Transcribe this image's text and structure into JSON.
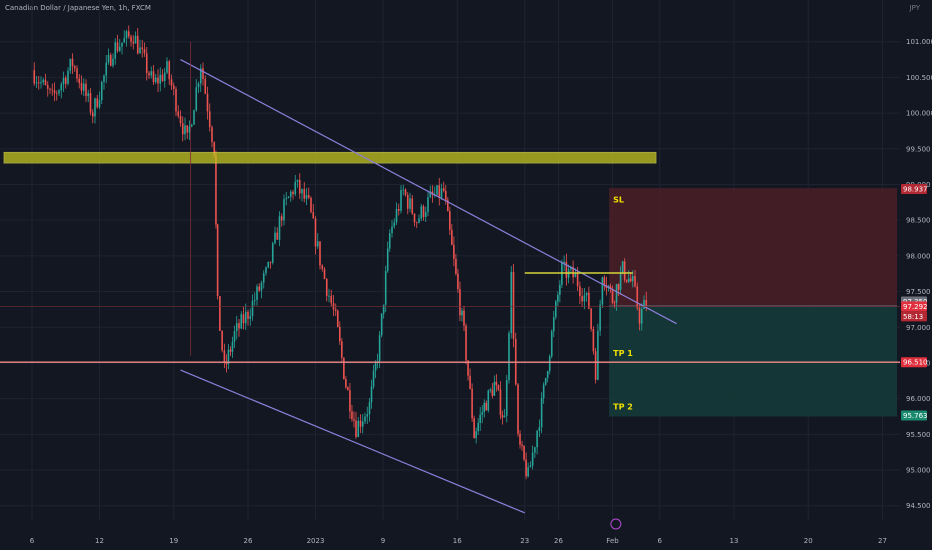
{
  "header": {
    "symbol": "Canadian Dollar / Japanese Yen, 1h, FXCM",
    "currency": "JPY"
  },
  "chart_data": {
    "type": "candlestick",
    "title": "Canadian Dollar / Japanese Yen, 1h, FXCM",
    "ylim": [
      94.3,
      101.5
    ],
    "y_ticks": [
      "94.500",
      "95.000",
      "95.500",
      "96.000",
      "96.500",
      "97.000",
      "97.500",
      "98.000",
      "98.500",
      "99.000",
      "99.500",
      "100.000",
      "100.500",
      "101.000"
    ],
    "x_ticks": [
      "6",
      "12",
      "19",
      "26",
      "2023",
      "9",
      "16",
      "23",
      "26",
      "Feb",
      "6",
      "13",
      "20",
      "27"
    ],
    "x_tick_index": [
      0,
      1.0,
      2.1,
      3.2,
      4.2,
      5.2,
      6.3,
      7.3,
      7.8,
      8.6,
      9.3,
      10.4,
      11.5,
      12.6
    ],
    "price_path": [
      [
        0,
        100.6
      ],
      [
        0.3,
        100.2
      ],
      [
        0.6,
        100.7
      ],
      [
        0.9,
        100.0
      ],
      [
        1.2,
        100.9
      ],
      [
        1.5,
        101.1
      ],
      [
        1.8,
        100.4
      ],
      [
        2.0,
        100.6
      ],
      [
        2.3,
        99.6
      ],
      [
        2.5,
        100.7
      ],
      [
        2.7,
        99.5
      ],
      [
        2.75,
        97.3
      ],
      [
        2.85,
        96.4
      ],
      [
        3.0,
        96.9
      ],
      [
        3.2,
        97.2
      ],
      [
        3.5,
        97.8
      ],
      [
        3.7,
        98.6
      ],
      [
        3.9,
        99.0
      ],
      [
        4.1,
        98.7
      ],
      [
        4.3,
        97.8
      ],
      [
        4.5,
        97.1
      ],
      [
        4.65,
        96.2
      ],
      [
        4.8,
        95.6
      ],
      [
        5.0,
        95.9
      ],
      [
        5.15,
        96.8
      ],
      [
        5.3,
        98.3
      ],
      [
        5.5,
        98.9
      ],
      [
        5.7,
        98.5
      ],
      [
        5.9,
        98.8
      ],
      [
        6.1,
        98.9
      ],
      [
        6.25,
        97.9
      ],
      [
        6.4,
        96.9
      ],
      [
        6.55,
        95.5
      ],
      [
        6.7,
        95.9
      ],
      [
        6.85,
        96.2
      ],
      [
        7.0,
        95.7
      ],
      [
        7.1,
        97.7
      ],
      [
        7.2,
        95.4
      ],
      [
        7.35,
        94.9
      ],
      [
        7.55,
        95.9
      ],
      [
        7.7,
        96.9
      ],
      [
        7.85,
        97.8
      ],
      [
        8.05,
        97.7
      ],
      [
        8.25,
        97.3
      ],
      [
        8.35,
        96.4
      ],
      [
        8.45,
        97.8
      ],
      [
        8.6,
        97.4
      ],
      [
        8.75,
        97.8
      ],
      [
        8.9,
        97.6
      ],
      [
        9.0,
        97.15
      ],
      [
        9.1,
        97.35
      ]
    ],
    "price_labels": {
      "sl": "98.937",
      "current": "97.350",
      "current2": "97.292",
      "countdown": "58:13",
      "tp1": "96.510",
      "tp2": "95.763"
    },
    "zones": {
      "sl_label": "SL",
      "tp1_label": "TP 1",
      "tp2_label": "TP 2"
    },
    "grid": true
  },
  "colors": {
    "bg": "#131722",
    "up": "#26a69a",
    "down": "#ef5350",
    "channel": "#8b7fd9",
    "zone": "#c3c31e",
    "stop": "#4b1f26",
    "target": "#163a38",
    "label": "#f0e000"
  }
}
